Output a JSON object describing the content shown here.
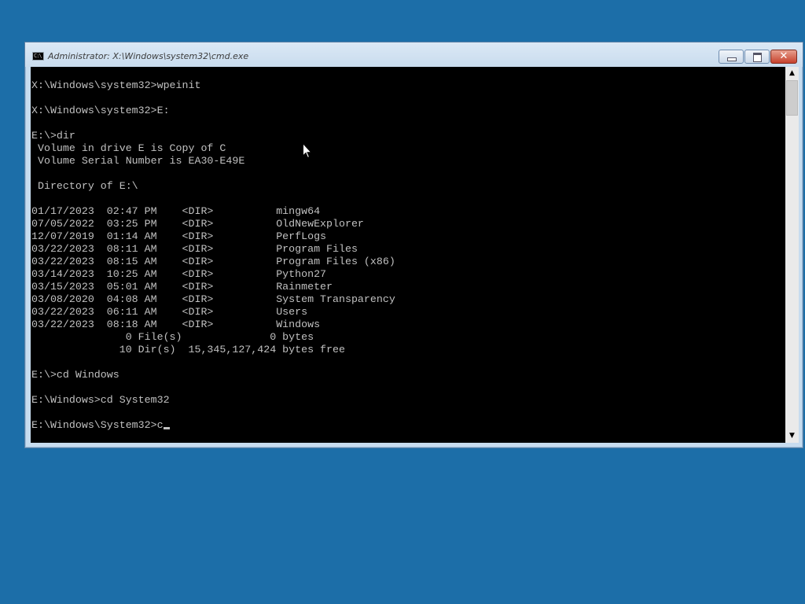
{
  "window": {
    "title": "Administrator: X:\\Windows\\system32\\cmd.exe",
    "icon": "cmd-icon",
    "icon_text": "C:\\",
    "buttons": {
      "minimize": "minimize-icon",
      "maximize": "maximize-icon",
      "close": "close-icon",
      "close_glyph": "✕"
    }
  },
  "console": {
    "lines": [
      "X:\\Windows\\system32>wpeinit",
      "",
      "X:\\Windows\\system32>E:",
      "",
      "E:\\>dir",
      " Volume in drive E is Copy of C",
      " Volume Serial Number is EA30-E49E",
      "",
      " Directory of E:\\",
      "",
      "01/17/2023  02:47 PM    <DIR>          mingw64",
      "07/05/2022  03:25 PM    <DIR>          OldNewExplorer",
      "12/07/2019  01:14 AM    <DIR>          PerfLogs",
      "03/22/2023  08:11 AM    <DIR>          Program Files",
      "03/22/2023  08:15 AM    <DIR>          Program Files (x86)",
      "03/14/2023  10:25 AM    <DIR>          Python27",
      "03/15/2023  05:01 AM    <DIR>          Rainmeter",
      "03/08/2020  04:08 AM    <DIR>          System Transparency",
      "03/22/2023  06:11 AM    <DIR>          Users",
      "03/22/2023  08:18 AM    <DIR>          Windows",
      "               0 File(s)              0 bytes",
      "              10 Dir(s)  15,345,127,424 bytes free",
      "",
      "E:\\>cd Windows",
      "",
      "E:\\Windows>cd System32",
      ""
    ],
    "prompt": "E:\\Windows\\System32>",
    "input": "c"
  },
  "scrollbar": {
    "up": "▲",
    "down": "▼"
  },
  "colors": {
    "desktop": "#1c6ea8",
    "console_bg": "#000000",
    "console_fg": "#c0c0c0",
    "close_button": "#c6412d"
  }
}
